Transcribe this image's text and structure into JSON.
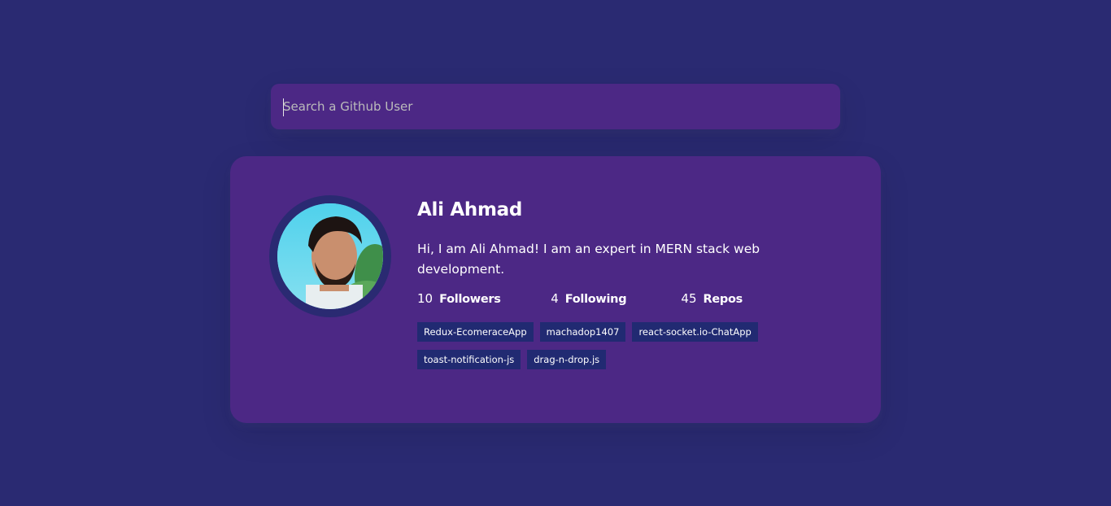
{
  "search": {
    "placeholder": "Search a Github User",
    "value": ""
  },
  "profile": {
    "name": "Ali Ahmad",
    "bio": "Hi, I am Ali Ahmad! I am an expert in MERN stack web development.",
    "stats": {
      "followers_count": "10",
      "followers_label": "Followers",
      "following_count": "4",
      "following_label": "Following",
      "repos_count": "45",
      "repos_label": "Repos"
    },
    "repos": [
      "Redux-EcomeraceApp",
      "machadop1407",
      "react-socket.io-ChatApp",
      "toast-notification-js",
      "drag-n-drop.js"
    ]
  },
  "colors": {
    "background": "#2a2a72",
    "card": "#4c2885",
    "repo_badge": "#212a72",
    "text": "#ffffff"
  }
}
